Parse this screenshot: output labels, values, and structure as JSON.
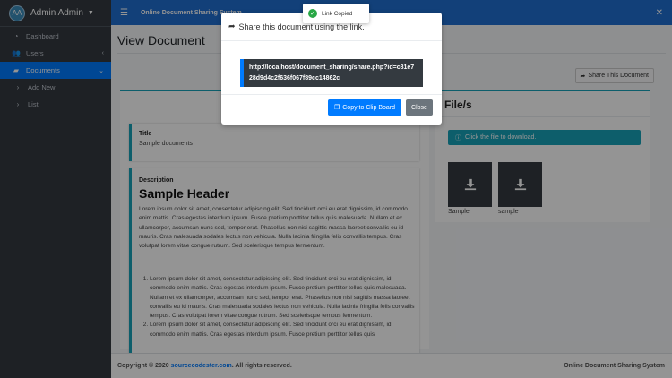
{
  "sidebar": {
    "avatar_initials": "AA",
    "user_name": "Admin Admin",
    "items": [
      {
        "label": "Dashboard",
        "icon": "dashboard-icon"
      },
      {
        "label": "Users",
        "icon": "users-icon"
      },
      {
        "label": "Documents",
        "icon": "folder-icon"
      },
      {
        "label": "Add New",
        "icon": "chevron-right-icon"
      },
      {
        "label": "List",
        "icon": "chevron-right-icon"
      }
    ]
  },
  "topbar": {
    "title": "Online Document Sharing System"
  },
  "main": {
    "page_title": "View Document",
    "share_button": "Share This Document",
    "title_label": "Title",
    "title_value": "Sample documents",
    "description_label": "Description",
    "description_header": "Sample Header",
    "paragraph": "Lorem ipsum dolor sit amet, consectetur adipiscing elit. Sed tincidunt orci eu erat dignissim, id commodo enim mattis. Cras egestas interdum ipsum. Fusce pretium porttitor tellus quis malesuada. Nullam et ex ullamcorper, accumsan nunc sed, tempor erat. Phasellus non nisi sagittis massa laoreet convallis eu id mauris. Cras malesuada sodales lectus non vehicula. Nulla lacinia fringilla felis convallis tempus. Cras volutpat lorem vitae congue rutrum. Sed scelerisque tempus fermentum.",
    "list_items": [
      "Lorem ipsum dolor sit amet, consectetur adipiscing elit. Sed tincidunt orci eu erat dignissim, id commodo enim mattis. Cras egestas interdum ipsum. Fusce pretium porttitor tellus quis malesuada. Nullam et ex ullamcorper, accumsan nunc sed, tempor erat. Phasellus non nisi sagittis massa laoreet convallis eu id mauris. Cras malesuada sodales lectus non vehicula. Nulla lacinia fringilla felis convallis tempus. Cras volutpat lorem vitae congue rutrum. Sed scelerisque tempus fermentum.",
      "Lorem ipsum dolor sit amet, consectetur adipiscing elit. Sed tincidunt orci eu erat dignissim, id commodo enim mattis. Cras egestas interdum ipsum. Fusce pretium porttitor tellus quis"
    ],
    "files_title": "File/s",
    "files_alert": "Click the file to download.",
    "files": [
      {
        "name": "Sample"
      },
      {
        "name": "sample"
      }
    ]
  },
  "footer": {
    "copyright_prefix": "Copyright © 2020 ",
    "copyright_link": "sourcecodester.com",
    "copyright_suffix": ". All rights reserved.",
    "right_text": "Online Document Sharing System"
  },
  "modal": {
    "title": "Share this document using the link.",
    "link": "http://localhost/document_sharing/share.php?id=c81e728d9d4c2f636f067f89cc14862c",
    "copy_button": "Copy to Clip Board",
    "close_button": "Close"
  },
  "toast": {
    "message": "Link Copied"
  },
  "colors": {
    "primary": "#007bff",
    "topbar": "#1f6fd1",
    "sidebar": "#343a40",
    "accent": "#17a2b8"
  }
}
